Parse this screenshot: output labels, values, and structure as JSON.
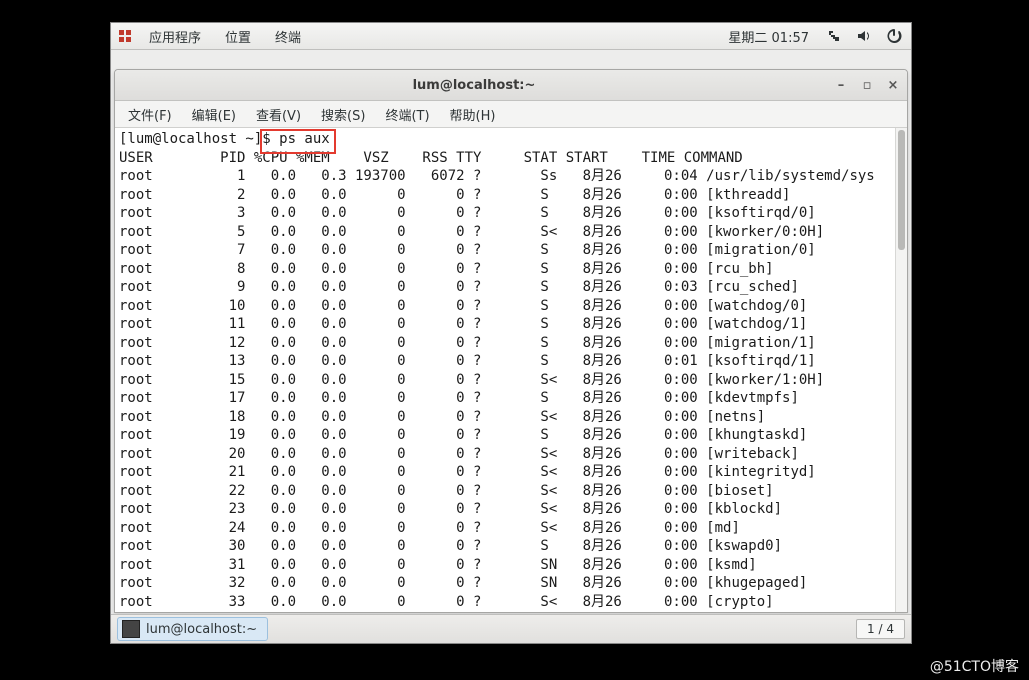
{
  "topbar": {
    "applications": "应用程序",
    "places": "位置",
    "terminal": "终端",
    "clock": "星期二 01:57"
  },
  "window": {
    "title": "lum@localhost:~"
  },
  "menu": {
    "file": "文件(F)",
    "edit": "编辑(E)",
    "view": "查看(V)",
    "search": "搜索(S)",
    "terminal": "终端(T)",
    "help": "帮助(H)"
  },
  "prompt": {
    "user_host": "[lum@localhost ~]",
    "command": "$ ps aux"
  },
  "ps": {
    "headers": {
      "user": "USER",
      "pid": "PID",
      "cpu": "%CPU",
      "mem": "%MEM",
      "vsz": "VSZ",
      "rss": "RSS",
      "tty": "TTY",
      "stat": "STAT",
      "start": "START",
      "time": "TIME",
      "command": "COMMAND"
    },
    "rows": [
      {
        "user": "root",
        "pid": 1,
        "cpu": "0.0",
        "mem": "0.3",
        "vsz": "193700",
        "rss": "6072",
        "tty": "?",
        "stat": "Ss",
        "start": "8月26",
        "time": "0:04",
        "command": "/usr/lib/systemd/sys"
      },
      {
        "user": "root",
        "pid": 2,
        "cpu": "0.0",
        "mem": "0.0",
        "vsz": "0",
        "rss": "0",
        "tty": "?",
        "stat": "S",
        "start": "8月26",
        "time": "0:00",
        "command": "[kthreadd]"
      },
      {
        "user": "root",
        "pid": 3,
        "cpu": "0.0",
        "mem": "0.0",
        "vsz": "0",
        "rss": "0",
        "tty": "?",
        "stat": "S",
        "start": "8月26",
        "time": "0:00",
        "command": "[ksoftirqd/0]"
      },
      {
        "user": "root",
        "pid": 5,
        "cpu": "0.0",
        "mem": "0.0",
        "vsz": "0",
        "rss": "0",
        "tty": "?",
        "stat": "S<",
        "start": "8月26",
        "time": "0:00",
        "command": "[kworker/0:0H]"
      },
      {
        "user": "root",
        "pid": 7,
        "cpu": "0.0",
        "mem": "0.0",
        "vsz": "0",
        "rss": "0",
        "tty": "?",
        "stat": "S",
        "start": "8月26",
        "time": "0:00",
        "command": "[migration/0]"
      },
      {
        "user": "root",
        "pid": 8,
        "cpu": "0.0",
        "mem": "0.0",
        "vsz": "0",
        "rss": "0",
        "tty": "?",
        "stat": "S",
        "start": "8月26",
        "time": "0:00",
        "command": "[rcu_bh]"
      },
      {
        "user": "root",
        "pid": 9,
        "cpu": "0.0",
        "mem": "0.0",
        "vsz": "0",
        "rss": "0",
        "tty": "?",
        "stat": "S",
        "start": "8月26",
        "time": "0:03",
        "command": "[rcu_sched]"
      },
      {
        "user": "root",
        "pid": 10,
        "cpu": "0.0",
        "mem": "0.0",
        "vsz": "0",
        "rss": "0",
        "tty": "?",
        "stat": "S",
        "start": "8月26",
        "time": "0:00",
        "command": "[watchdog/0]"
      },
      {
        "user": "root",
        "pid": 11,
        "cpu": "0.0",
        "mem": "0.0",
        "vsz": "0",
        "rss": "0",
        "tty": "?",
        "stat": "S",
        "start": "8月26",
        "time": "0:00",
        "command": "[watchdog/1]"
      },
      {
        "user": "root",
        "pid": 12,
        "cpu": "0.0",
        "mem": "0.0",
        "vsz": "0",
        "rss": "0",
        "tty": "?",
        "stat": "S",
        "start": "8月26",
        "time": "0:00",
        "command": "[migration/1]"
      },
      {
        "user": "root",
        "pid": 13,
        "cpu": "0.0",
        "mem": "0.0",
        "vsz": "0",
        "rss": "0",
        "tty": "?",
        "stat": "S",
        "start": "8月26",
        "time": "0:01",
        "command": "[ksoftirqd/1]"
      },
      {
        "user": "root",
        "pid": 15,
        "cpu": "0.0",
        "mem": "0.0",
        "vsz": "0",
        "rss": "0",
        "tty": "?",
        "stat": "S<",
        "start": "8月26",
        "time": "0:00",
        "command": "[kworker/1:0H]"
      },
      {
        "user": "root",
        "pid": 17,
        "cpu": "0.0",
        "mem": "0.0",
        "vsz": "0",
        "rss": "0",
        "tty": "?",
        "stat": "S",
        "start": "8月26",
        "time": "0:00",
        "command": "[kdevtmpfs]"
      },
      {
        "user": "root",
        "pid": 18,
        "cpu": "0.0",
        "mem": "0.0",
        "vsz": "0",
        "rss": "0",
        "tty": "?",
        "stat": "S<",
        "start": "8月26",
        "time": "0:00",
        "command": "[netns]"
      },
      {
        "user": "root",
        "pid": 19,
        "cpu": "0.0",
        "mem": "0.0",
        "vsz": "0",
        "rss": "0",
        "tty": "?",
        "stat": "S",
        "start": "8月26",
        "time": "0:00",
        "command": "[khungtaskd]"
      },
      {
        "user": "root",
        "pid": 20,
        "cpu": "0.0",
        "mem": "0.0",
        "vsz": "0",
        "rss": "0",
        "tty": "?",
        "stat": "S<",
        "start": "8月26",
        "time": "0:00",
        "command": "[writeback]"
      },
      {
        "user": "root",
        "pid": 21,
        "cpu": "0.0",
        "mem": "0.0",
        "vsz": "0",
        "rss": "0",
        "tty": "?",
        "stat": "S<",
        "start": "8月26",
        "time": "0:00",
        "command": "[kintegrityd]"
      },
      {
        "user": "root",
        "pid": 22,
        "cpu": "0.0",
        "mem": "0.0",
        "vsz": "0",
        "rss": "0",
        "tty": "?",
        "stat": "S<",
        "start": "8月26",
        "time": "0:00",
        "command": "[bioset]"
      },
      {
        "user": "root",
        "pid": 23,
        "cpu": "0.0",
        "mem": "0.0",
        "vsz": "0",
        "rss": "0",
        "tty": "?",
        "stat": "S<",
        "start": "8月26",
        "time": "0:00",
        "command": "[kblockd]"
      },
      {
        "user": "root",
        "pid": 24,
        "cpu": "0.0",
        "mem": "0.0",
        "vsz": "0",
        "rss": "0",
        "tty": "?",
        "stat": "S<",
        "start": "8月26",
        "time": "0:00",
        "command": "[md]"
      },
      {
        "user": "root",
        "pid": 30,
        "cpu": "0.0",
        "mem": "0.0",
        "vsz": "0",
        "rss": "0",
        "tty": "?",
        "stat": "S",
        "start": "8月26",
        "time": "0:00",
        "command": "[kswapd0]"
      },
      {
        "user": "root",
        "pid": 31,
        "cpu": "0.0",
        "mem": "0.0",
        "vsz": "0",
        "rss": "0",
        "tty": "?",
        "stat": "SN",
        "start": "8月26",
        "time": "0:00",
        "command": "[ksmd]"
      },
      {
        "user": "root",
        "pid": 32,
        "cpu": "0.0",
        "mem": "0.0",
        "vsz": "0",
        "rss": "0",
        "tty": "?",
        "stat": "SN",
        "start": "8月26",
        "time": "0:00",
        "command": "[khugepaged]"
      },
      {
        "user": "root",
        "pid": 33,
        "cpu": "0.0",
        "mem": "0.0",
        "vsz": "0",
        "rss": "0",
        "tty": "?",
        "stat": "S<",
        "start": "8月26",
        "time": "0:00",
        "command": "[crypto]"
      }
    ]
  },
  "taskbar": {
    "task_label": "lum@localhost:~",
    "workspace": "1 / 4"
  },
  "watermark": "@51CTO博客"
}
